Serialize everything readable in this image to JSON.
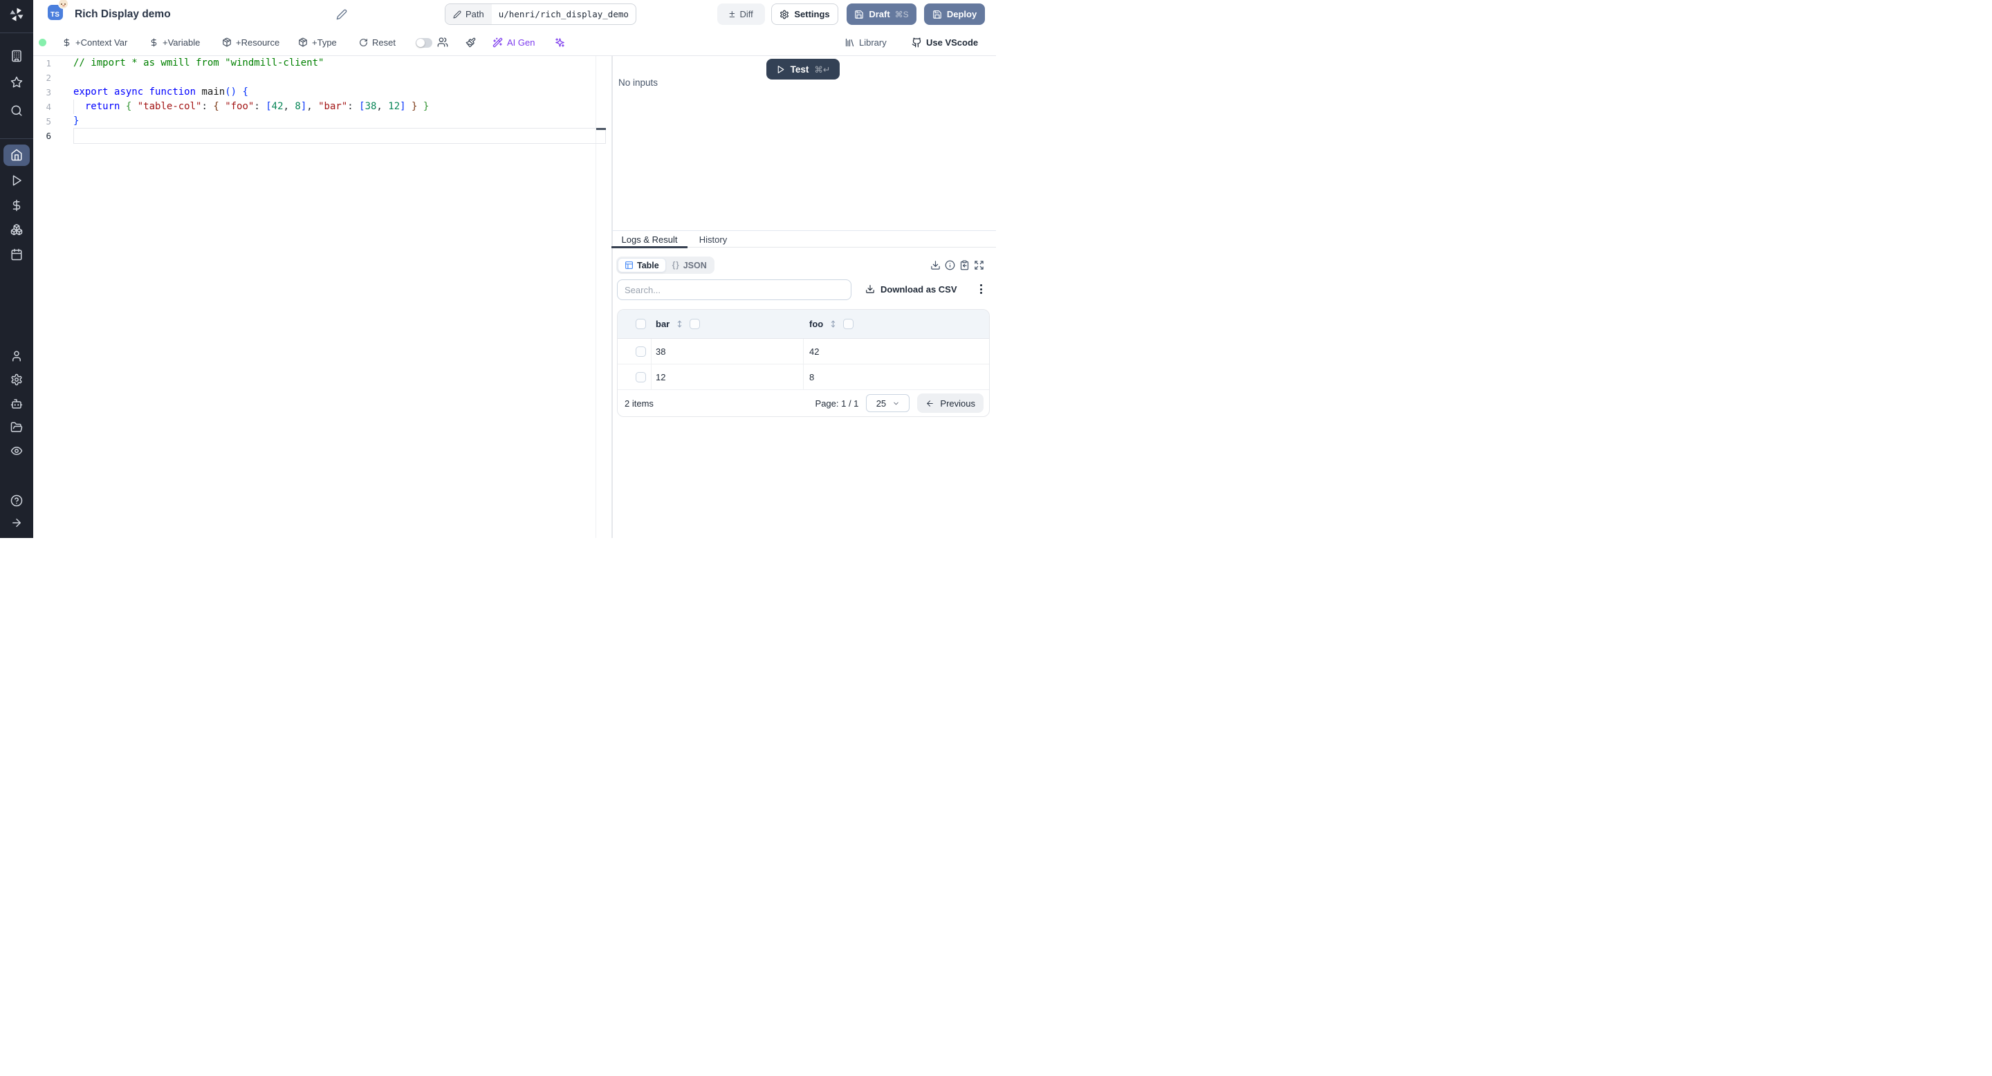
{
  "header": {
    "lang_badge": "TS",
    "title": "Rich Display demo",
    "path_label": "Path",
    "path_value": "u/henri/rich_display_demo",
    "diff": "Diff",
    "settings": "Settings",
    "draft": "Draft",
    "draft_shortcut": "⌘S",
    "deploy": "Deploy"
  },
  "toolbar": {
    "context_var": "+Context Var",
    "variable": "+Variable",
    "resource": "+Resource",
    "type": "+Type",
    "reset": "Reset",
    "ai_gen": "AI Gen",
    "library": "Library",
    "vscode": "Use VScode"
  },
  "sidebar": {
    "icons": [
      "windmill-logo",
      "building",
      "star",
      "search",
      "home",
      "play",
      "dollar",
      "boxes",
      "calendar",
      "user",
      "settings",
      "bot",
      "folder-open",
      "eye",
      "help-circle",
      "arrow-right"
    ]
  },
  "editor": {
    "lines": [
      {
        "n": "1",
        "tokens": [
          {
            "c": "comment",
            "t": "// import * as wmill from \"windmill-client\""
          }
        ]
      },
      {
        "n": "2",
        "tokens": []
      },
      {
        "n": "3",
        "tokens": [
          {
            "c": "kw",
            "t": "export"
          },
          {
            "c": "pl",
            "t": " "
          },
          {
            "c": "kw",
            "t": "async"
          },
          {
            "c": "pl",
            "t": " "
          },
          {
            "c": "kw",
            "t": "function"
          },
          {
            "c": "pl",
            "t": " "
          },
          {
            "c": "id",
            "t": "main"
          },
          {
            "c": "b1",
            "t": "()"
          },
          {
            "c": "pl",
            "t": " "
          },
          {
            "c": "b1",
            "t": "{"
          }
        ]
      },
      {
        "n": "4",
        "tokens": [
          {
            "c": "pl",
            "t": "  "
          },
          {
            "c": "kw",
            "t": "return"
          },
          {
            "c": "pl",
            "t": " "
          },
          {
            "c": "b2",
            "t": "{"
          },
          {
            "c": "pl",
            "t": " "
          },
          {
            "c": "str",
            "t": "\"table-col\""
          },
          {
            "c": "pl",
            "t": ": "
          },
          {
            "c": "b3",
            "t": "{"
          },
          {
            "c": "pl",
            "t": " "
          },
          {
            "c": "str",
            "t": "\"foo\""
          },
          {
            "c": "pl",
            "t": ": "
          },
          {
            "c": "b1",
            "t": "["
          },
          {
            "c": "num",
            "t": "42"
          },
          {
            "c": "pl",
            "t": ", "
          },
          {
            "c": "num",
            "t": "8"
          },
          {
            "c": "b1",
            "t": "]"
          },
          {
            "c": "pl",
            "t": ", "
          },
          {
            "c": "str",
            "t": "\"bar\""
          },
          {
            "c": "pl",
            "t": ": "
          },
          {
            "c": "b1",
            "t": "["
          },
          {
            "c": "num",
            "t": "38"
          },
          {
            "c": "pl",
            "t": ", "
          },
          {
            "c": "num",
            "t": "12"
          },
          {
            "c": "b1",
            "t": "]"
          },
          {
            "c": "pl",
            "t": " "
          },
          {
            "c": "b3",
            "t": "}"
          },
          {
            "c": "pl",
            "t": " "
          },
          {
            "c": "b2",
            "t": "}"
          }
        ]
      },
      {
        "n": "5",
        "tokens": [
          {
            "c": "b1",
            "t": "}"
          }
        ]
      },
      {
        "n": "6",
        "tokens": [],
        "current": true
      }
    ]
  },
  "run": {
    "test": "Test",
    "test_shortcut": "⌘↵",
    "no_inputs": "No inputs"
  },
  "result": {
    "tabs": [
      {
        "label": "Logs & Result",
        "active": true
      },
      {
        "label": "History",
        "active": false
      }
    ],
    "views": [
      {
        "label": "Table",
        "active": true
      },
      {
        "label": "JSON",
        "active": false
      }
    ],
    "json_glyph": "{}",
    "search_placeholder": "Search...",
    "download_csv": "Download as CSV",
    "table": {
      "columns": [
        "bar",
        "foo"
      ],
      "rows": [
        [
          "38",
          "42"
        ],
        [
          "12",
          "8"
        ]
      ]
    },
    "footer": {
      "count": "2 items",
      "page": "Page: 1 / 1",
      "page_size": "25",
      "previous": "Previous"
    }
  },
  "colors": {
    "accent_purple": "#7c3aed",
    "action_blue": "#65799e",
    "test_btn": "#334155",
    "ts_badge": "#4b7fdd",
    "table_icon": "#3b82f6",
    "status_dot": "#86efac",
    "sidebar_bg": "#1e222c",
    "sidebar_active": "#4c5d80"
  }
}
